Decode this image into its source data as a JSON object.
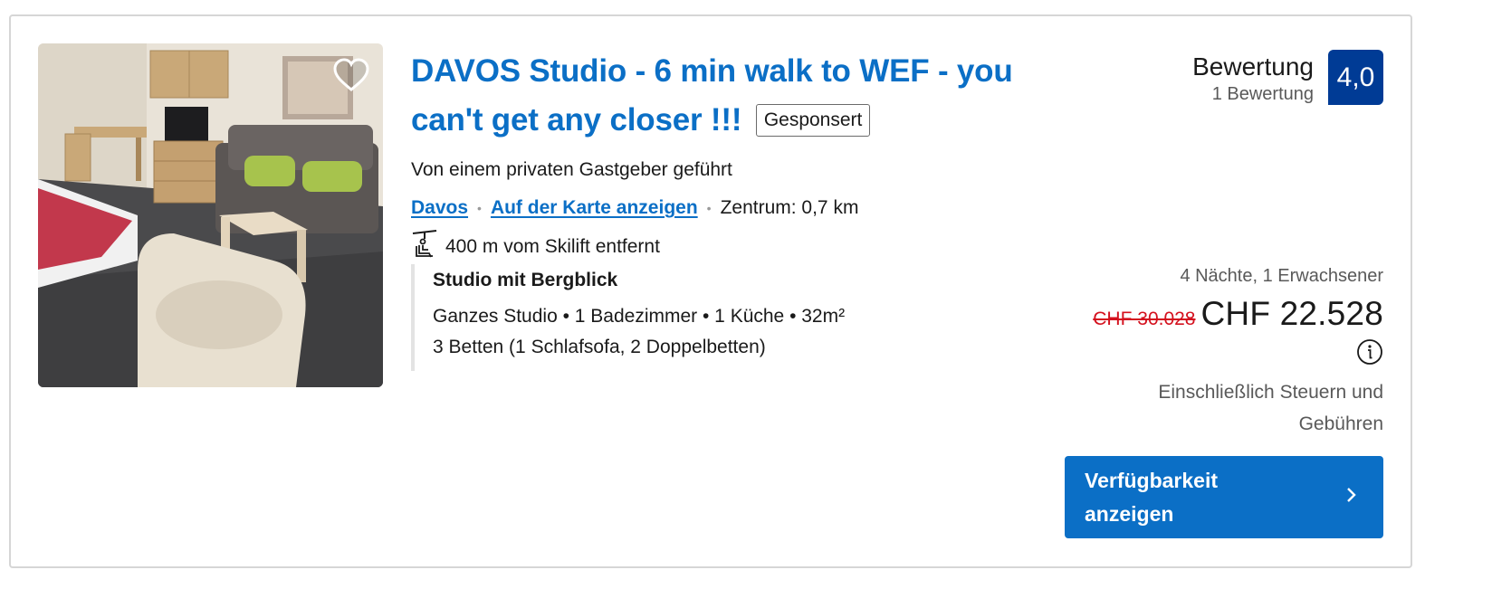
{
  "listing": {
    "title": "DAVOS Studio - 6 min walk to WEF - you can't get any closer !!!",
    "sponsored_badge": "Gesponsert",
    "host_note": "Von einem privaten Gastgeber geführt",
    "location": {
      "city_link": "Davos",
      "map_link": "Auf der Karte anzeigen",
      "distance_center": "Zentrum: 0,7 km"
    },
    "ski_lift": "400 m vom Skilift entfernt",
    "unit": {
      "name": "Studio mit Bergblick",
      "details": "Ganzes Studio • 1 Badezimmer • 1 Küche • 32m²",
      "beds": "3 Betten (1 Schlafsofa, 2 Doppelbetten)"
    }
  },
  "rating": {
    "label": "Bewertung",
    "count": "1 Bewertung",
    "score": "4,0"
  },
  "price": {
    "stay_summary": "4 Nächte, 1 Erwachsener",
    "old_price": "CHF 30.028",
    "new_price": "CHF 22.528",
    "tax_note": "Einschließlich Steuern und Gebühren"
  },
  "cta": {
    "label": "Verfügbarkeit anzeigen"
  },
  "icons": {
    "favorite": "heart-icon",
    "ski": "ski-lift-icon",
    "info": "info-icon",
    "cta_arrow": "chevron-right-icon"
  },
  "colors": {
    "link_blue": "#0b6fc6",
    "badge_navy": "#003b95",
    "old_price_red": "#d4111e"
  }
}
